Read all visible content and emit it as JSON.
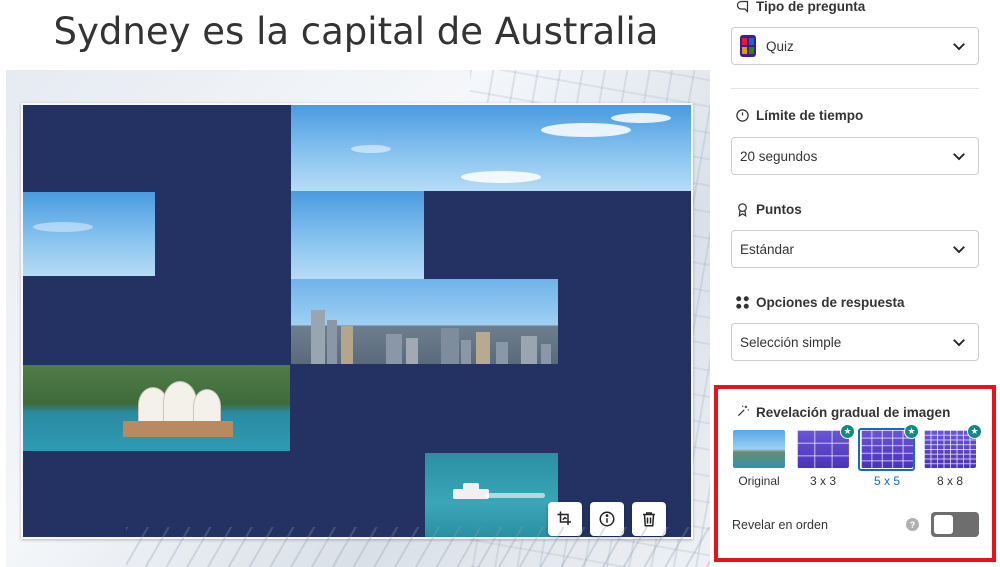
{
  "question": {
    "title": "Sydney es la capital de Australia"
  },
  "panel": {
    "question_type": {
      "label": "Tipo de pregunta",
      "value": "Quiz"
    },
    "time_limit": {
      "label": "Límite de tiempo",
      "value": "20 segundos"
    },
    "points": {
      "label": "Puntos",
      "value": "Estándar"
    },
    "answer_options": {
      "label": "Opciones de respuesta",
      "value": "Selección simple"
    },
    "image_reveal": {
      "label": "Revelación gradual de imagen",
      "options": [
        {
          "caption": "Original",
          "premium": false,
          "selected": false
        },
        {
          "caption": "3 x 3",
          "premium": true,
          "selected": false
        },
        {
          "caption": "5 x 5",
          "premium": true,
          "selected": true
        },
        {
          "caption": "8 x 8",
          "premium": true,
          "selected": false
        }
      ],
      "reveal_in_order": {
        "label": "Revelar en orden",
        "enabled": false
      }
    }
  },
  "colors": {
    "accent": "#1368ce",
    "highlight": "#e8121b",
    "mask": "#233262",
    "premium": "#138a80"
  },
  "icons": [
    "crop-icon",
    "info-icon",
    "trash-icon",
    "quiz-icon",
    "clock-icon",
    "award-icon",
    "grid-dots-icon",
    "magic-wand-icon",
    "chevron-down-icon",
    "star-icon",
    "help-icon"
  ]
}
